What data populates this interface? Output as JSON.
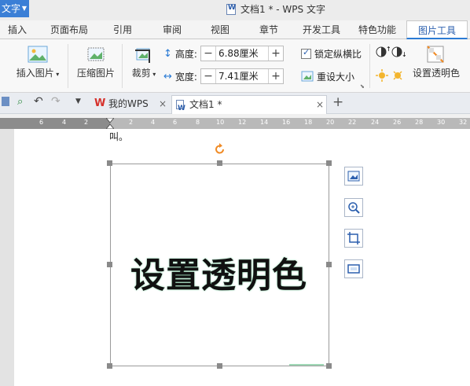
{
  "app": {
    "label": "文字",
    "window_title": "文档1 * - WPS 文字"
  },
  "menu": {
    "items": [
      "插入",
      "页面布局",
      "引用",
      "审阅",
      "视图",
      "章节",
      "开发工具",
      "特色功能"
    ],
    "active": "图片工具"
  },
  "ribbon": {
    "insert_picture": "插入图片",
    "compress_picture": "压缩图片",
    "crop": "裁剪",
    "height_label": "高度:",
    "height_value": "6.88厘米",
    "width_label": "宽度:",
    "width_value": "7.41厘米",
    "lock_ratio": "锁定纵横比",
    "reset_size": "重设大小",
    "set_transparent": "设置透明色"
  },
  "tabs": {
    "home": "我的WPS",
    "doc": "文档1 *"
  },
  "ruler": {
    "ticks": [
      "6",
      "4",
      "2",
      "2",
      "4",
      "6",
      "8",
      "10",
      "12",
      "14",
      "16",
      "18",
      "20",
      "22",
      "24",
      "26",
      "28",
      "30",
      "32"
    ]
  },
  "document": {
    "caption_fragment": "叫。",
    "image_text": "设置透明色"
  }
}
